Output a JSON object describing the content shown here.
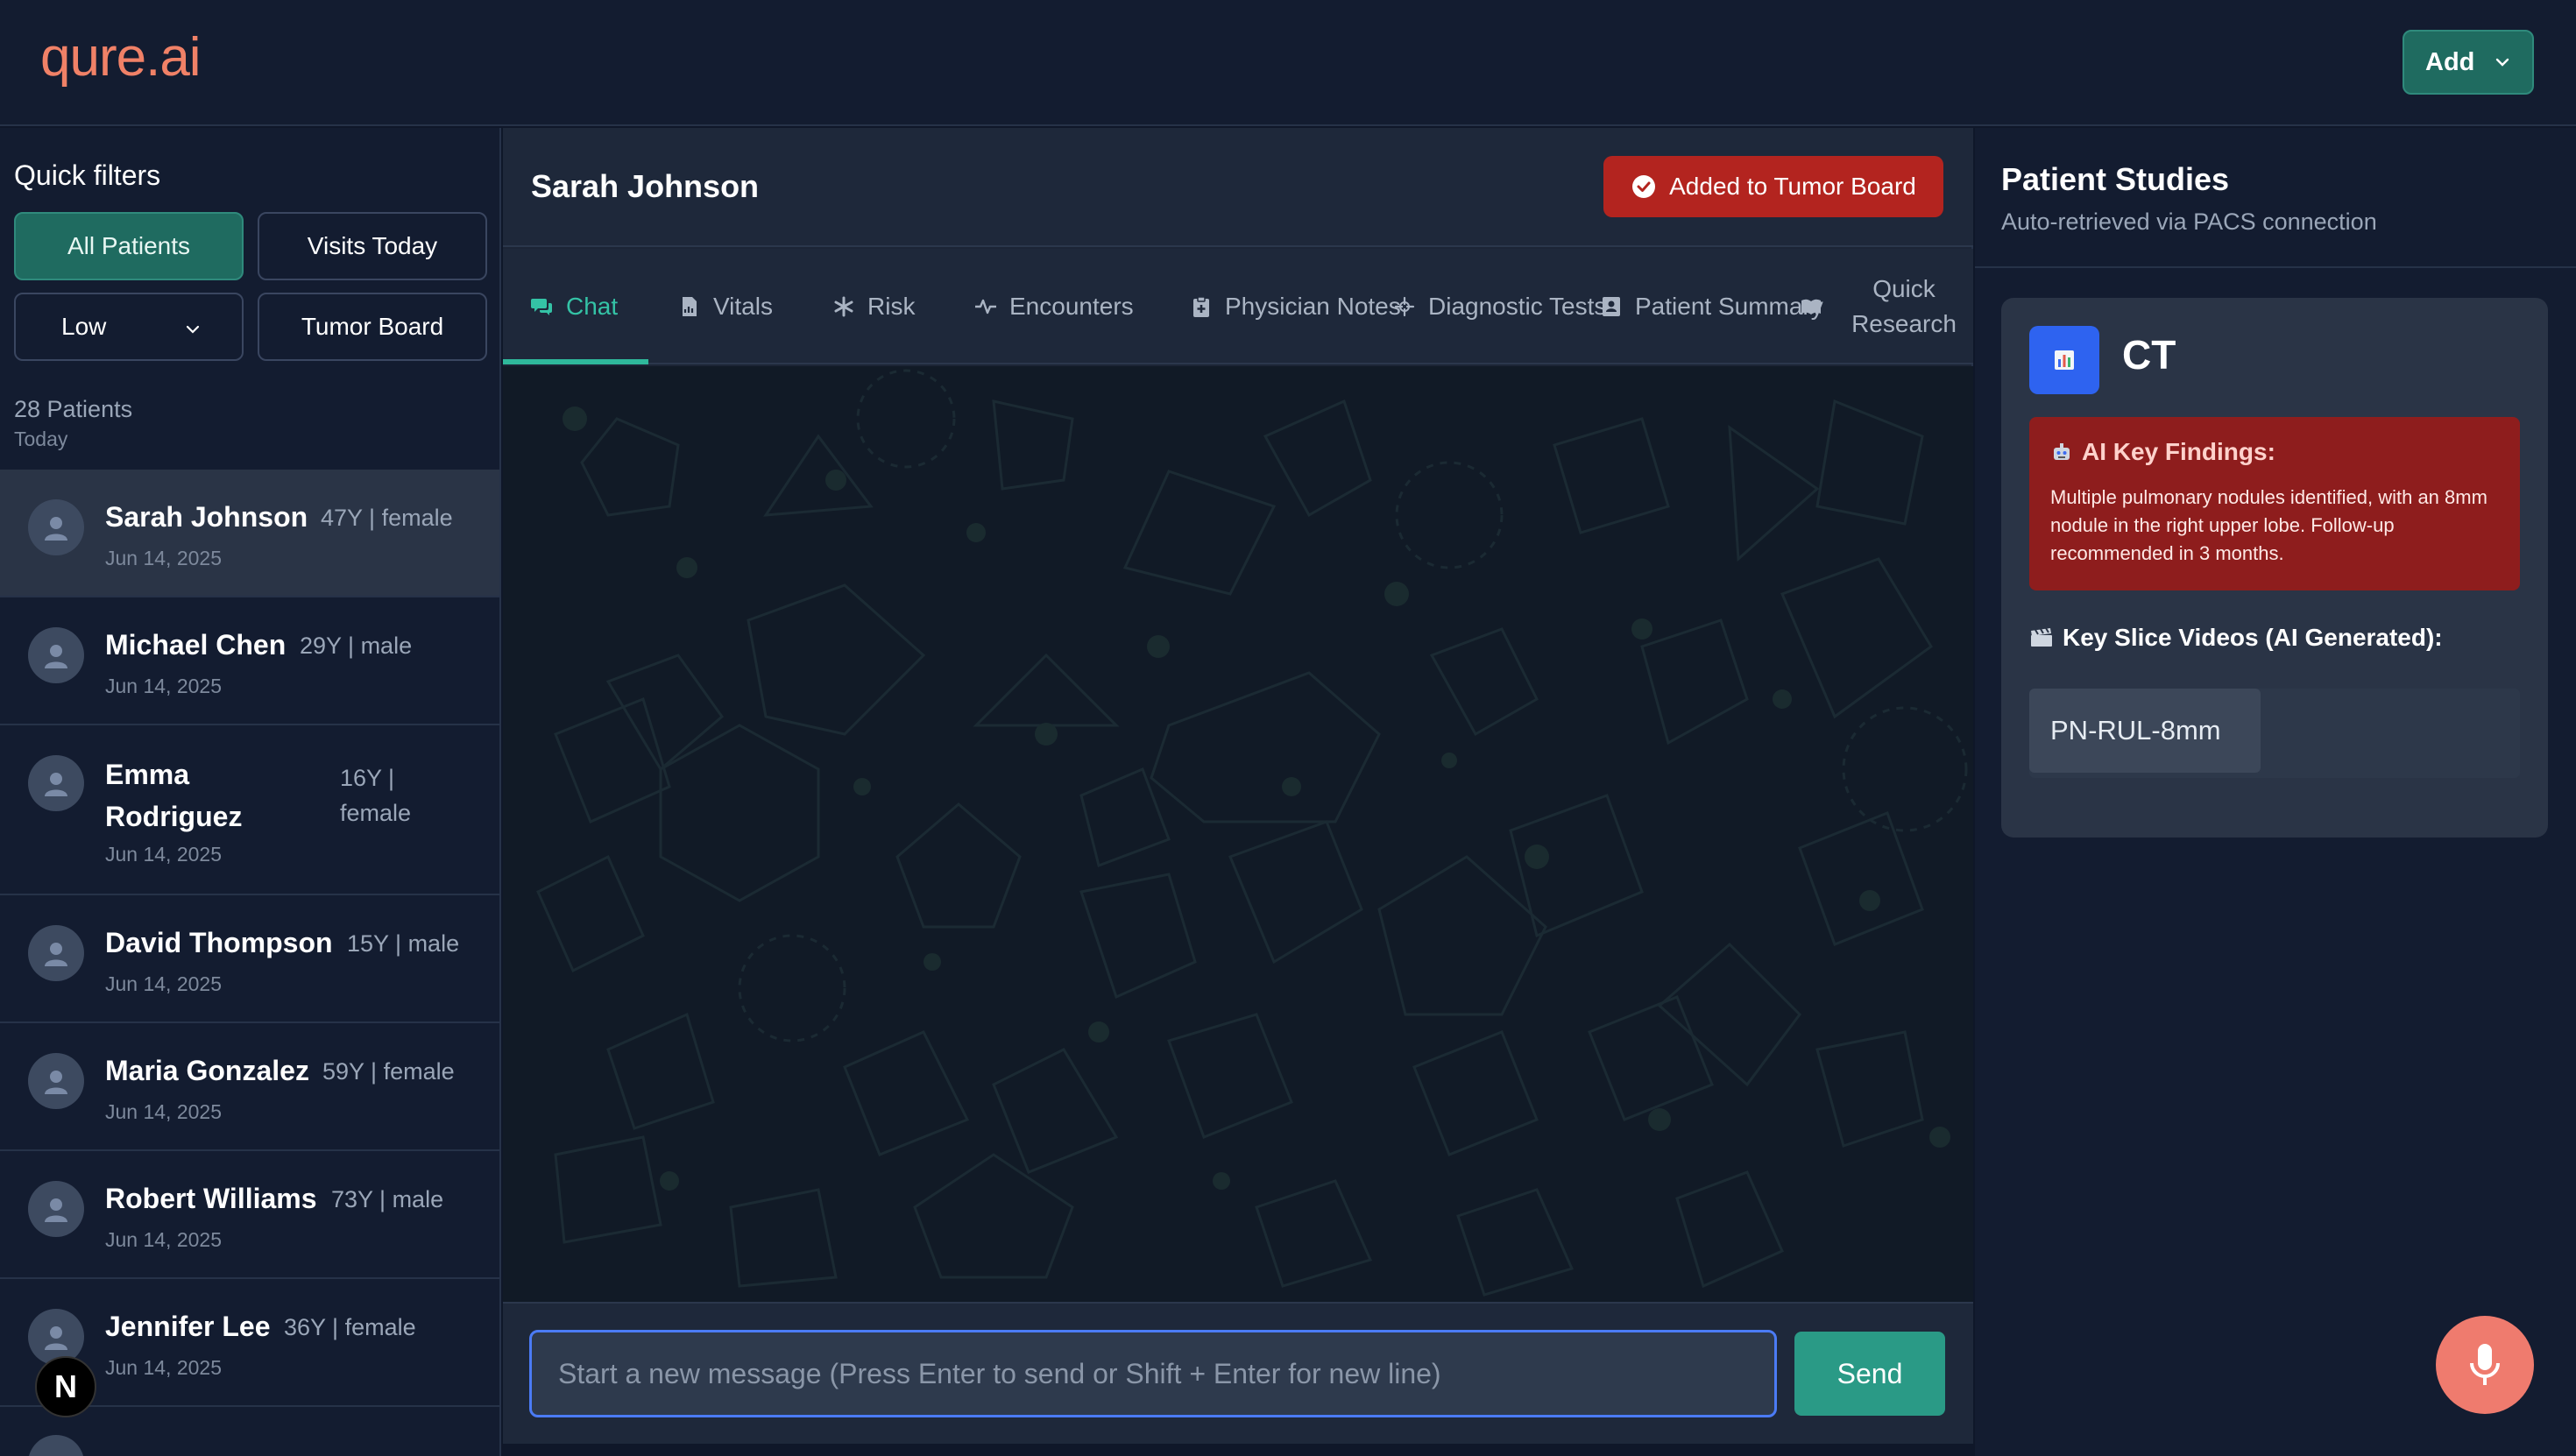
{
  "app": {
    "logo": "qure.ai",
    "add_label": "Add"
  },
  "sidebar": {
    "quick_filters_title": "Quick filters",
    "filters": {
      "all_patients": "All Patients",
      "visits_today": "Visits Today",
      "priority_select": "Low",
      "tumor_board": "Tumor Board"
    },
    "patient_count": "28 Patients",
    "day_label": "Today",
    "patients": [
      {
        "name": "Sarah Johnson",
        "meta": "47Y | female",
        "date": "Jun 14, 2025"
      },
      {
        "name": "Michael Chen",
        "meta": "29Y | male",
        "date": "Jun 14, 2025"
      },
      {
        "name": "Emma Rodriguez",
        "meta": "16Y | female",
        "date": "Jun 14, 2025"
      },
      {
        "name": "David Thompson",
        "meta": "15Y | male",
        "date": "Jun 14, 2025"
      },
      {
        "name": "Maria Gonzalez",
        "meta": "59Y | female",
        "date": "Jun 14, 2025"
      },
      {
        "name": "Robert Williams",
        "meta": "73Y | male",
        "date": "Jun 14, 2025"
      },
      {
        "name": "Jennifer Lee",
        "meta": "36Y | female",
        "date": "Jun 14, 2025"
      }
    ],
    "badge_letter": "N"
  },
  "chat": {
    "patient_name": "Sarah Johnson",
    "tumor_board_status": "Added to Tumor Board",
    "tabs": [
      {
        "label": "Chat",
        "icon": "chat-bubbles-icon"
      },
      {
        "label": "Vitals",
        "icon": "document-chart-icon"
      },
      {
        "label": "Risk",
        "icon": "asterisk-icon"
      },
      {
        "label": "Encounters",
        "icon": "pulse-icon"
      },
      {
        "label": "Physician Notes",
        "icon": "clipboard-plus-icon"
      },
      {
        "label": "Diagnostic Tests",
        "icon": "crosshair-icon"
      },
      {
        "label": "Patient Summary",
        "icon": "patient-file-icon"
      },
      {
        "label": "Quick Research",
        "icon": "open-book-icon"
      }
    ],
    "input_placeholder": "Start a new message (Press Enter to send or Shift + Enter for new line)",
    "send_label": "Send"
  },
  "studies": {
    "title": "Patient Studies",
    "subtitle": "Auto-retrieved via PACS connection",
    "card": {
      "modality": "CT",
      "findings_title": "AI Key Findings:",
      "findings_text": "Multiple pulmonary nodules identified, with an 8mm nodule in the right upper lobe. Follow-up recommended in 3 months.",
      "key_slice_title": "Key Slice Videos (AI Generated):",
      "key_slice_items": [
        "PN-RUL-8mm"
      ]
    }
  },
  "colors": {
    "accent_teal": "#1f6b60",
    "tab_active": "#34c3a6",
    "danger": "#b3241f",
    "brand": "#f08167",
    "input_focus": "#4b7bf5"
  }
}
